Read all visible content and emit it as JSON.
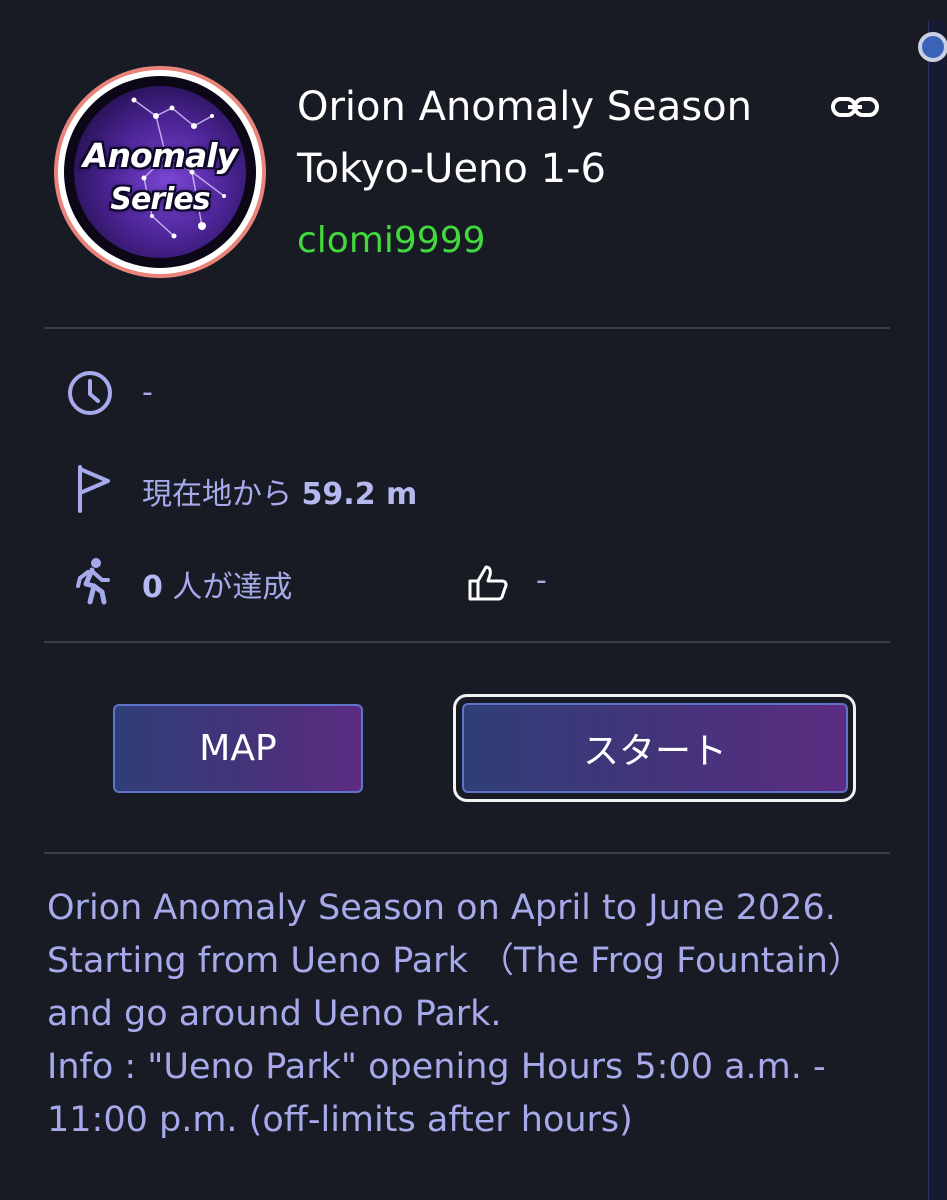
{
  "header": {
    "badge_text_line1": "Anomaly",
    "badge_text_line2": "Series",
    "title_line1": "Orion Anomaly Season",
    "title_line2": "Tokyo-Ueno 1-6",
    "author": "clomi9999",
    "link_icon": "link-icon"
  },
  "info": {
    "time_value": "-",
    "distance_prefix": "現在地から",
    "distance_value": "59.2 m",
    "achievers_count": "0",
    "achievers_suffix": "人が達成",
    "likes_value": "-"
  },
  "buttons": {
    "map_label": "MAP",
    "start_label": "スタート"
  },
  "description": {
    "lines": [
      "Orion Anomaly Season on April to June 2026.",
      "Starting from Ueno Park （The Frog Fountain）",
      "and go around Ueno Park.",
      "Info : \"Ueno Park\" opening Hours 5:00 a.m. -",
      "11:00 p.m. (off-limits after hours)"
    ]
  },
  "colors": {
    "background": "#181b24",
    "author": "#43d93c",
    "info_text": "#a7aaea",
    "button_border": "#5f73c8"
  }
}
